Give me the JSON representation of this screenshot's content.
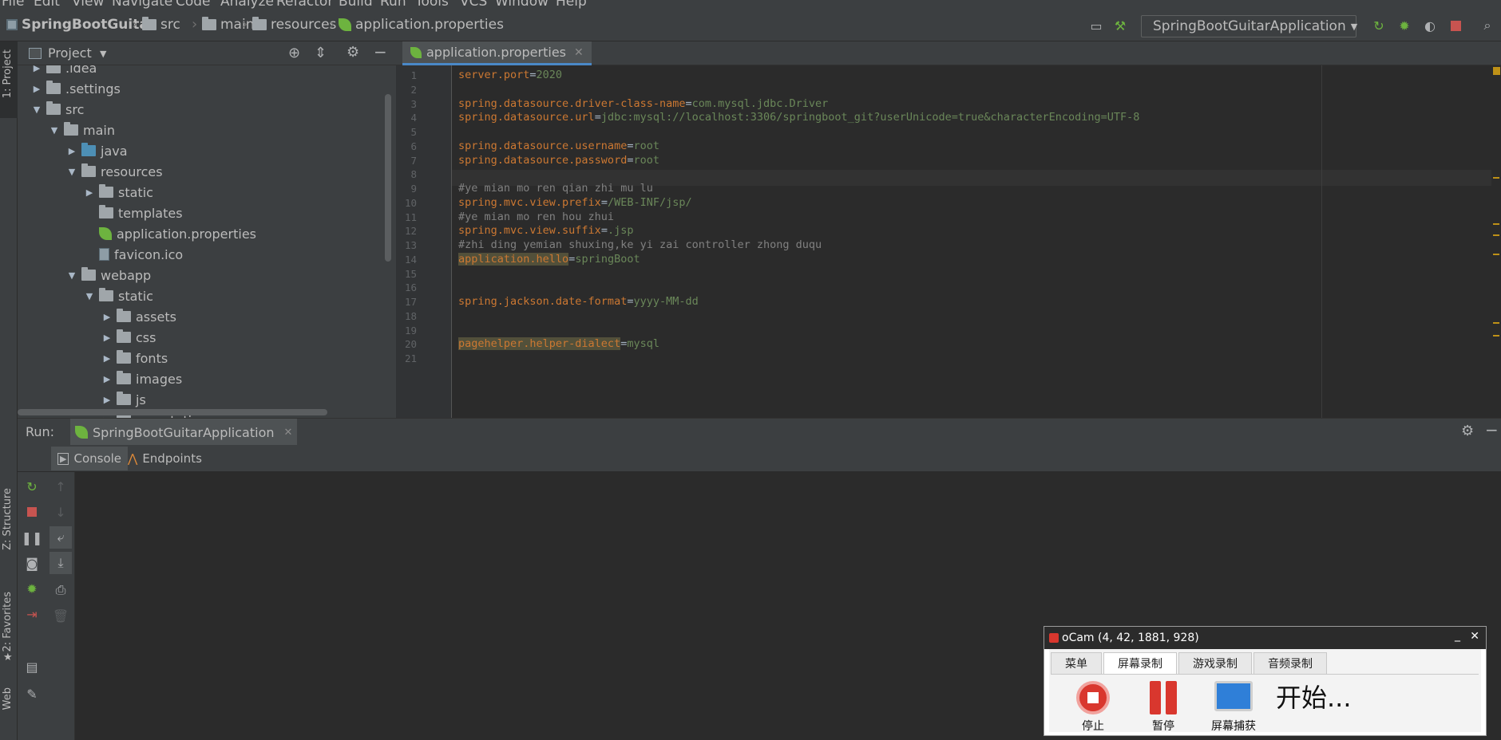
{
  "menu": {
    "items": [
      "File",
      "Edit",
      "View",
      "Navigate",
      "Code",
      "Analyze",
      "Refactor",
      "Build",
      "Run",
      "Tools",
      "VCS",
      "Window",
      "Help"
    ]
  },
  "breadcrumb": {
    "project": "SpringBootGuitar",
    "items": [
      "src",
      "main",
      "resources",
      "application.properties"
    ]
  },
  "run_config": {
    "label": "SpringBootGuitarApplication"
  },
  "left_strip": {
    "project_label": "1: Project",
    "structure_label": "Z: Structure",
    "favorites_label": "2: Favorites",
    "web_label": "Web"
  },
  "project_panel": {
    "title": "Project",
    "tree": [
      {
        "label": ".idea",
        "level": 1,
        "type": "folder",
        "expanded": false
      },
      {
        "label": ".settings",
        "level": 1,
        "type": "folder",
        "expanded": false
      },
      {
        "label": "src",
        "level": 1,
        "type": "folder",
        "expanded": true
      },
      {
        "label": "main",
        "level": 2,
        "type": "folder",
        "expanded": true
      },
      {
        "label": "java",
        "level": 3,
        "type": "folder-blue",
        "expanded": false
      },
      {
        "label": "resources",
        "level": 3,
        "type": "folder",
        "expanded": true
      },
      {
        "label": "static",
        "level": 4,
        "type": "folder",
        "expanded": false
      },
      {
        "label": "templates",
        "level": 4,
        "type": "folder",
        "expanded": null
      },
      {
        "label": "application.properties",
        "level": 4,
        "type": "spring-file",
        "expanded": null
      },
      {
        "label": "favicon.ico",
        "level": 4,
        "type": "file",
        "expanded": null
      },
      {
        "label": "webapp",
        "level": 3,
        "type": "folder",
        "expanded": true
      },
      {
        "label": "static",
        "level": 4,
        "type": "folder",
        "expanded": true
      },
      {
        "label": "assets",
        "level": 5,
        "type": "folder",
        "expanded": false
      },
      {
        "label": "css",
        "level": 5,
        "type": "folder",
        "expanded": false
      },
      {
        "label": "fonts",
        "level": 5,
        "type": "folder",
        "expanded": false
      },
      {
        "label": "images",
        "level": 5,
        "type": "folder",
        "expanded": false
      },
      {
        "label": "js",
        "level": 5,
        "type": "folder",
        "expanded": false
      },
      {
        "label": "userstatic",
        "level": 5,
        "type": "folder",
        "expanded": false
      }
    ]
  },
  "editor": {
    "tab": "application.properties",
    "lines": [
      {
        "n": "1",
        "key": "server.port",
        "val": "2020"
      },
      {
        "n": "2"
      },
      {
        "n": "3",
        "key": "spring.datasource.driver-class-name",
        "val": "com.mysql.jdbc.Driver"
      },
      {
        "n": "4",
        "key": "spring.datasource.url",
        "val": "jdbc:mysql://localhost:3306/springboot_git?userUnicode=true&characterEncoding=UTF-8"
      },
      {
        "n": "5"
      },
      {
        "n": "6",
        "key": "spring.datasource.username",
        "val": "root"
      },
      {
        "n": "7",
        "key": "spring.datasource.password",
        "val": "root"
      },
      {
        "n": "8"
      },
      {
        "n": "9",
        "comment": "#ye mian mo ren qian zhi mu lu"
      },
      {
        "n": "10",
        "key": "spring.mvc.view.prefix",
        "val": "/WEB-INF/jsp/"
      },
      {
        "n": "11",
        "comment": "#ye mian mo ren hou zhui"
      },
      {
        "n": "12",
        "key": "spring.mvc.view.suffix",
        "val": ".jsp"
      },
      {
        "n": "13",
        "comment": "#zhi ding yemian shuxing,ke yi zai controller zhong duqu"
      },
      {
        "n": "14",
        "key": "application.hello",
        "val": "springBoot",
        "hl": true
      },
      {
        "n": "15"
      },
      {
        "n": "16"
      },
      {
        "n": "17",
        "key": "spring.jackson.date-format",
        "val": "yyyy-MM-dd"
      },
      {
        "n": "18"
      },
      {
        "n": "19"
      },
      {
        "n": "20",
        "key": "pagehelper.helper-dialect",
        "val": "mysql",
        "hl": true
      },
      {
        "n": "21"
      }
    ]
  },
  "run_panel": {
    "label": "Run:",
    "config": "SpringBootGuitarApplication",
    "tabs": [
      "Console",
      "Endpoints"
    ]
  },
  "ocam": {
    "title": "oCam (4, 42, 1881, 928)",
    "tabs": [
      "菜单",
      "屏幕录制",
      "游戏录制",
      "音频录制"
    ],
    "buttons": [
      "停止",
      "暂停",
      "屏幕捕获"
    ],
    "status": "开始..."
  },
  "colors": {
    "accent": "#4a88c7",
    "spring": "#6db33f",
    "keyword": "#cc7832",
    "value": "#6a8759"
  }
}
